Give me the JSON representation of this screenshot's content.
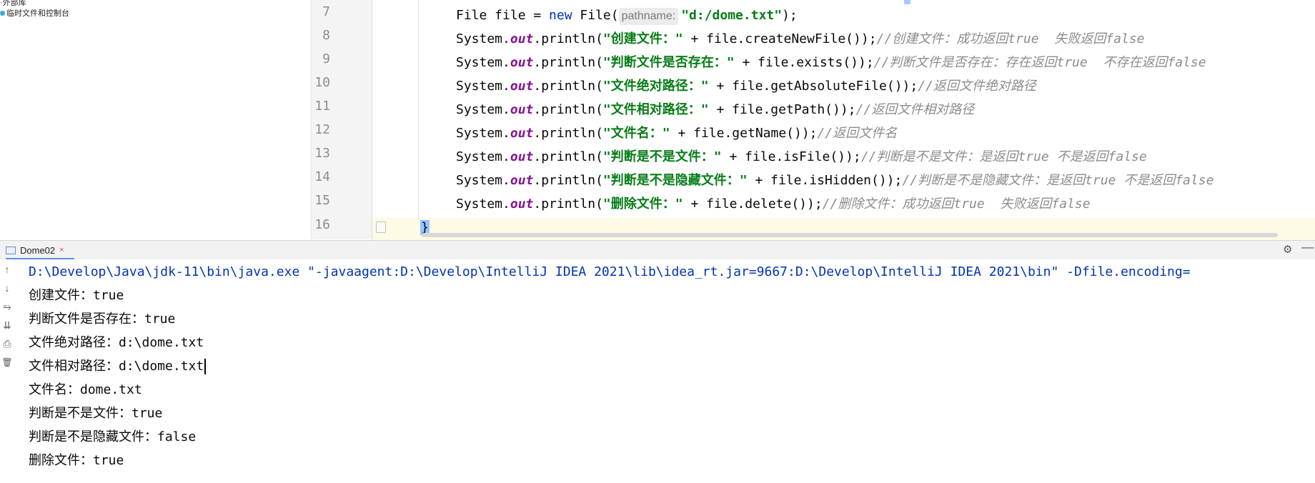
{
  "project_panel": {
    "items": [
      {
        "label": "·外部库"
      },
      {
        "label": "临时文件和控制台"
      }
    ]
  },
  "editor": {
    "line_numbers": [
      "7",
      "8",
      "9",
      "10",
      "11",
      "12",
      "13",
      "14",
      "15",
      "16"
    ],
    "lines": [
      {
        "pre": "File file = ",
        "kw": "new",
        "mid": " File(",
        "hint": "pathname:",
        "str": "\"d:/dome.txt\"",
        "post": ");"
      },
      {
        "pre": "System.",
        "field": "out",
        "mid": ".println(",
        "str": "\"创建文件：\"",
        "post": " + file.createNewFile());",
        "comment": "//创建文件：成功返回true  失败返回false"
      },
      {
        "pre": "System.",
        "field": "out",
        "mid": ".println(",
        "str": "\"判断文件是否存在：\"",
        "post": " + file.exists());",
        "comment": "//判断文件是否存在：存在返回true  不存在返回false"
      },
      {
        "pre": "System.",
        "field": "out",
        "mid": ".println(",
        "str": "\"文件绝对路径：\"",
        "post": " + file.getAbsoluteFile());",
        "comment": "//返回文件绝对路径"
      },
      {
        "pre": "System.",
        "field": "out",
        "mid": ".println(",
        "str": "\"文件相对路径：\"",
        "post": " + file.getPath());",
        "comment": "//返回文件相对路径"
      },
      {
        "pre": "System.",
        "field": "out",
        "mid": ".println(",
        "str": "\"文件名：\"",
        "post": " + file.getName());",
        "comment": "//返回文件名"
      },
      {
        "pre": "System.",
        "field": "out",
        "mid": ".println(",
        "str": "\"判断是不是文件：\"",
        "post": " + file.isFile());",
        "comment": "//判断是不是文件：是返回true 不是返回false"
      },
      {
        "pre": "System.",
        "field": "out",
        "mid": ".println(",
        "str": "\"判断是不是隐藏文件：\"",
        "post": " + file.isHidden());",
        "comment": "//判断是不是隐藏文件：是返回true 不是返回false"
      },
      {
        "pre": "System.",
        "field": "out",
        "mid": ".println(",
        "str": "\"删除文件：\"",
        "post": " + file.delete());",
        "comment": "//删除文件：成功返回true  失败返回false"
      },
      {
        "brace": "}"
      }
    ]
  },
  "run_window": {
    "tab_label": "Dome02",
    "close_glyph": "×",
    "gear_glyph": "⚙",
    "minimize_glyph": "—",
    "toolbar_icons": [
      {
        "name": "rerun-up-icon",
        "glyph": "↑"
      },
      {
        "name": "scroll-down-icon",
        "glyph": "↓"
      },
      {
        "name": "soft-wrap-icon",
        "glyph": "⥱"
      },
      {
        "name": "scroll-to-end-icon",
        "glyph": "⇊"
      },
      {
        "name": "print-icon",
        "glyph": "⎙"
      },
      {
        "name": "trash-icon",
        "glyph": "🗑"
      }
    ],
    "output_lines": [
      "D:\\Develop\\Java\\jdk-11\\bin\\java.exe \"-javaagent:D:\\Develop\\IntelliJ IDEA 2021\\lib\\idea_rt.jar=9667:D:\\Develop\\IntelliJ IDEA 2021\\bin\" -Dfile.encoding=",
      "创建文件：true",
      "判断文件是否存在：true",
      "文件绝对路径：d:\\dome.txt",
      "文件相对路径：d:\\dome.txt",
      "文件名：dome.txt",
      "判断是不是文件：true",
      "判断是不是隐藏文件：false",
      "删除文件：true"
    ]
  },
  "colors": {
    "keyword": "#0033b3",
    "string": "#067d17",
    "field": "#871094",
    "comment": "#8c8c8c",
    "current_line": "#fdfbe5"
  }
}
